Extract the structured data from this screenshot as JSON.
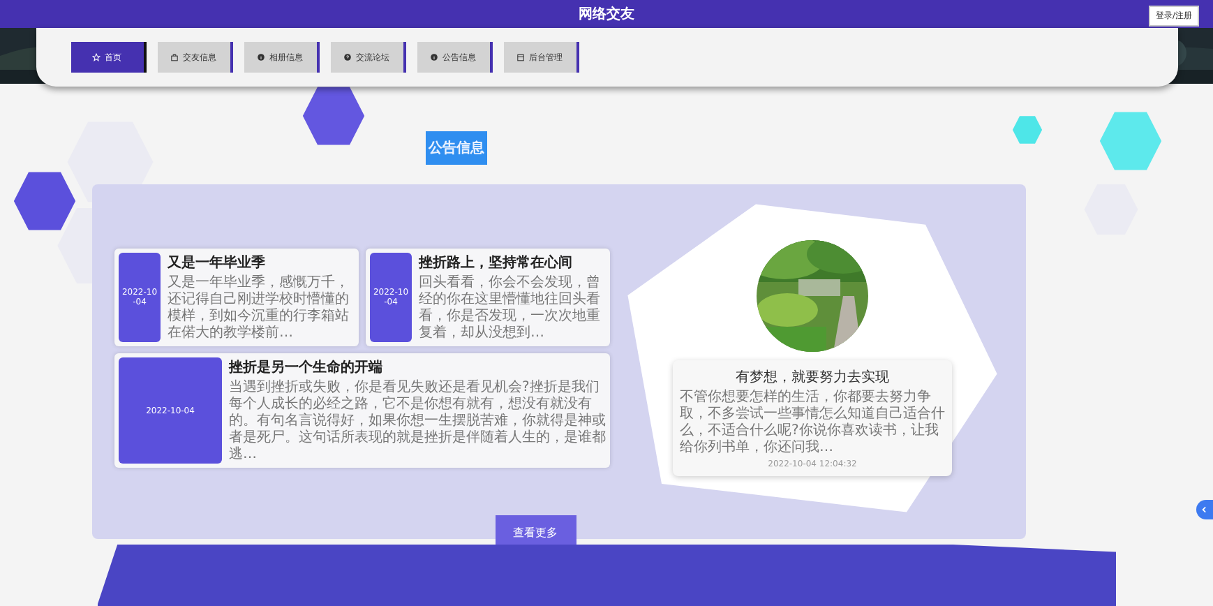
{
  "header": {
    "title": "网络交友",
    "login_button": "登录/注册"
  },
  "nav": [
    {
      "label": "首页",
      "selected": true
    },
    {
      "label": "交友信息",
      "selected": false
    },
    {
      "label": "相册信息",
      "selected": false
    },
    {
      "label": "交流论坛",
      "selected": false
    },
    {
      "label": "公告信息",
      "selected": false
    },
    {
      "label": "后台管理",
      "selected": false
    }
  ],
  "section_title": "公告信息",
  "notices": [
    {
      "date": "2022-10-04",
      "title": "又是一年毕业季",
      "text": "又是一年毕业季，感慨万千，还记得自己刚进学校时懵懂的模样，到如今沉重的行李箱站在偌大的教学楼前…"
    },
    {
      "date": "2022-10-04",
      "title": "挫折路上，坚持常在心间",
      "text": "回头看看，你会不会发现，曾经的你在这里懵懂地往回头看看，你是否发现，一次次地重复着，却从没想到…"
    },
    {
      "date": "2022-10-04",
      "title": "挫折是另一个生命的开端",
      "text": "当遇到挫折或失败，你是看见失败还是看见机会?挫折是我们每个人成长的必经之路，它不是你想有就有，想没有就没有的。有句名言说得好，如果你想一生摆脱苦难，你就得是神或者是死尸。这句话所表现的就是挫折是伴随着人生的，是谁都逃…"
    }
  ],
  "featured": {
    "title": "有梦想，就要努力去实现",
    "text": "不管你想要怎样的生活，你都要去努力争取，不多尝试一些事情怎么知道自己适合什么，不适合什么呢?你说你喜欢读书，让我给你列书单，你还问我…",
    "time": "2022-10-04 12:04:32"
  },
  "more_button": "查看更多"
}
